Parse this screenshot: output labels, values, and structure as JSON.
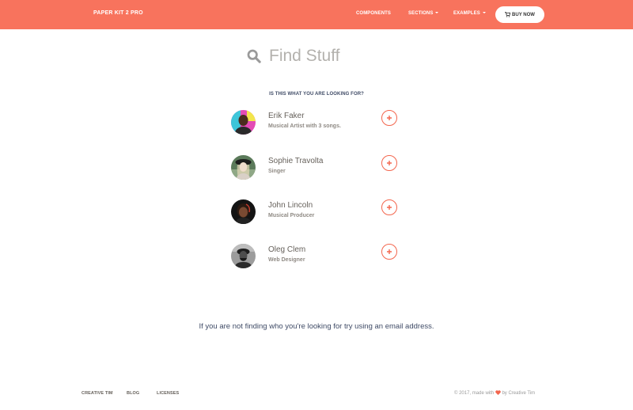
{
  "navbar": {
    "brand": "PAPER KIT 2 PRO",
    "links": [
      "COMPONENTS",
      "SECTIONS",
      "EXAMPLES"
    ],
    "buy_label": "BUY NOW",
    "color": "#f8735d"
  },
  "search": {
    "placeholder": "Find Stuff",
    "value": ""
  },
  "results": {
    "title": "IS THIS WHAT YOU ARE LOOKING FOR?",
    "people": [
      {
        "name": "Erik Faker",
        "role": "Musical Artist with 3 songs."
      },
      {
        "name": "Sophie Travolta",
        "role": "Singer"
      },
      {
        "name": "John Lincoln",
        "role": "Musical Producer"
      },
      {
        "name": "Oleg Clem",
        "role": "Web Designer"
      }
    ]
  },
  "hint": "If you are not finding who you're looking for try using an email address.",
  "footer": {
    "links": [
      "CREATIVE TIM",
      "BLOG",
      "LICENSES"
    ],
    "copyright_prefix": "© 2017, made with",
    "copyright_suffix": "by Creative Tim"
  },
  "colors": {
    "accent": "#f3664e",
    "heart": "#f3664e",
    "text": "#66615b"
  }
}
